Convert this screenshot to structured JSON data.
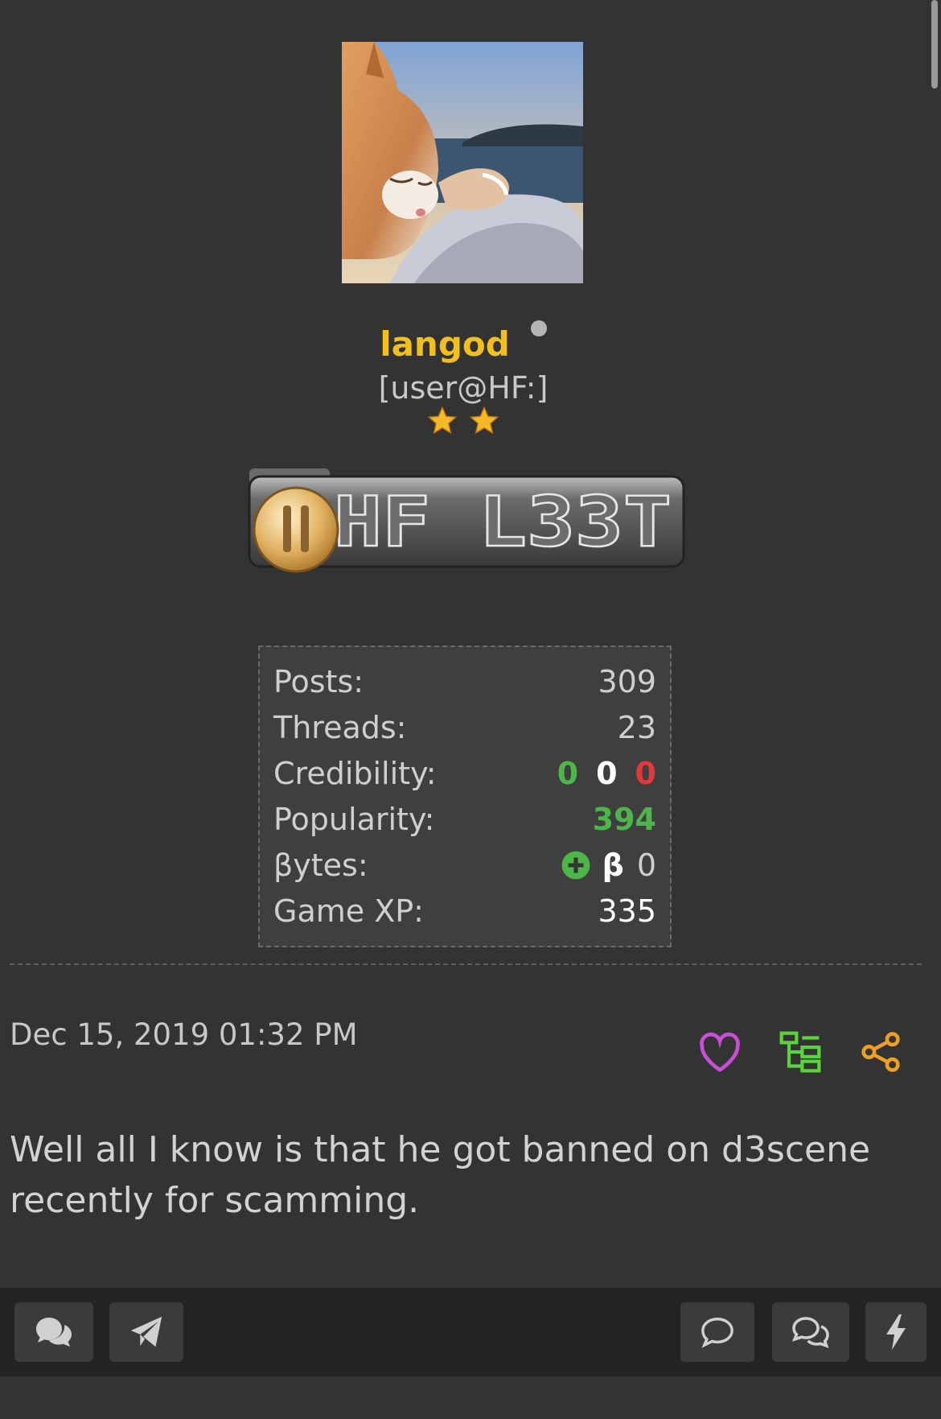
{
  "profile": {
    "username": "langod",
    "user_title": "[user@HF:]",
    "star_count": 2,
    "rank_badge_text": "HF L33T",
    "avatar_description": "sleeping cat avatar"
  },
  "stats": [
    {
      "label": "Posts:",
      "value": "309"
    },
    {
      "label": "Threads:",
      "value": "23"
    },
    {
      "label": "Credibility:",
      "positive": "0",
      "neutral": "0",
      "negative": "0"
    },
    {
      "label": "Popularity:",
      "value": "394"
    },
    {
      "label": "βytes:",
      "symbol": "β",
      "value": "0"
    },
    {
      "label": "Game XP:",
      "value": "335"
    }
  ],
  "post": {
    "date": "Dec 15, 2019 01:32 PM",
    "body": "Well all I know is that he got banned on d3scene recently for scamming."
  },
  "colors": {
    "username": "#f2c01e",
    "positive": "#4cb648",
    "negative": "#e2383c",
    "like_icon": "#c94fd6",
    "tree_icon": "#5ad43a",
    "share_icon": "#f0a020"
  }
}
